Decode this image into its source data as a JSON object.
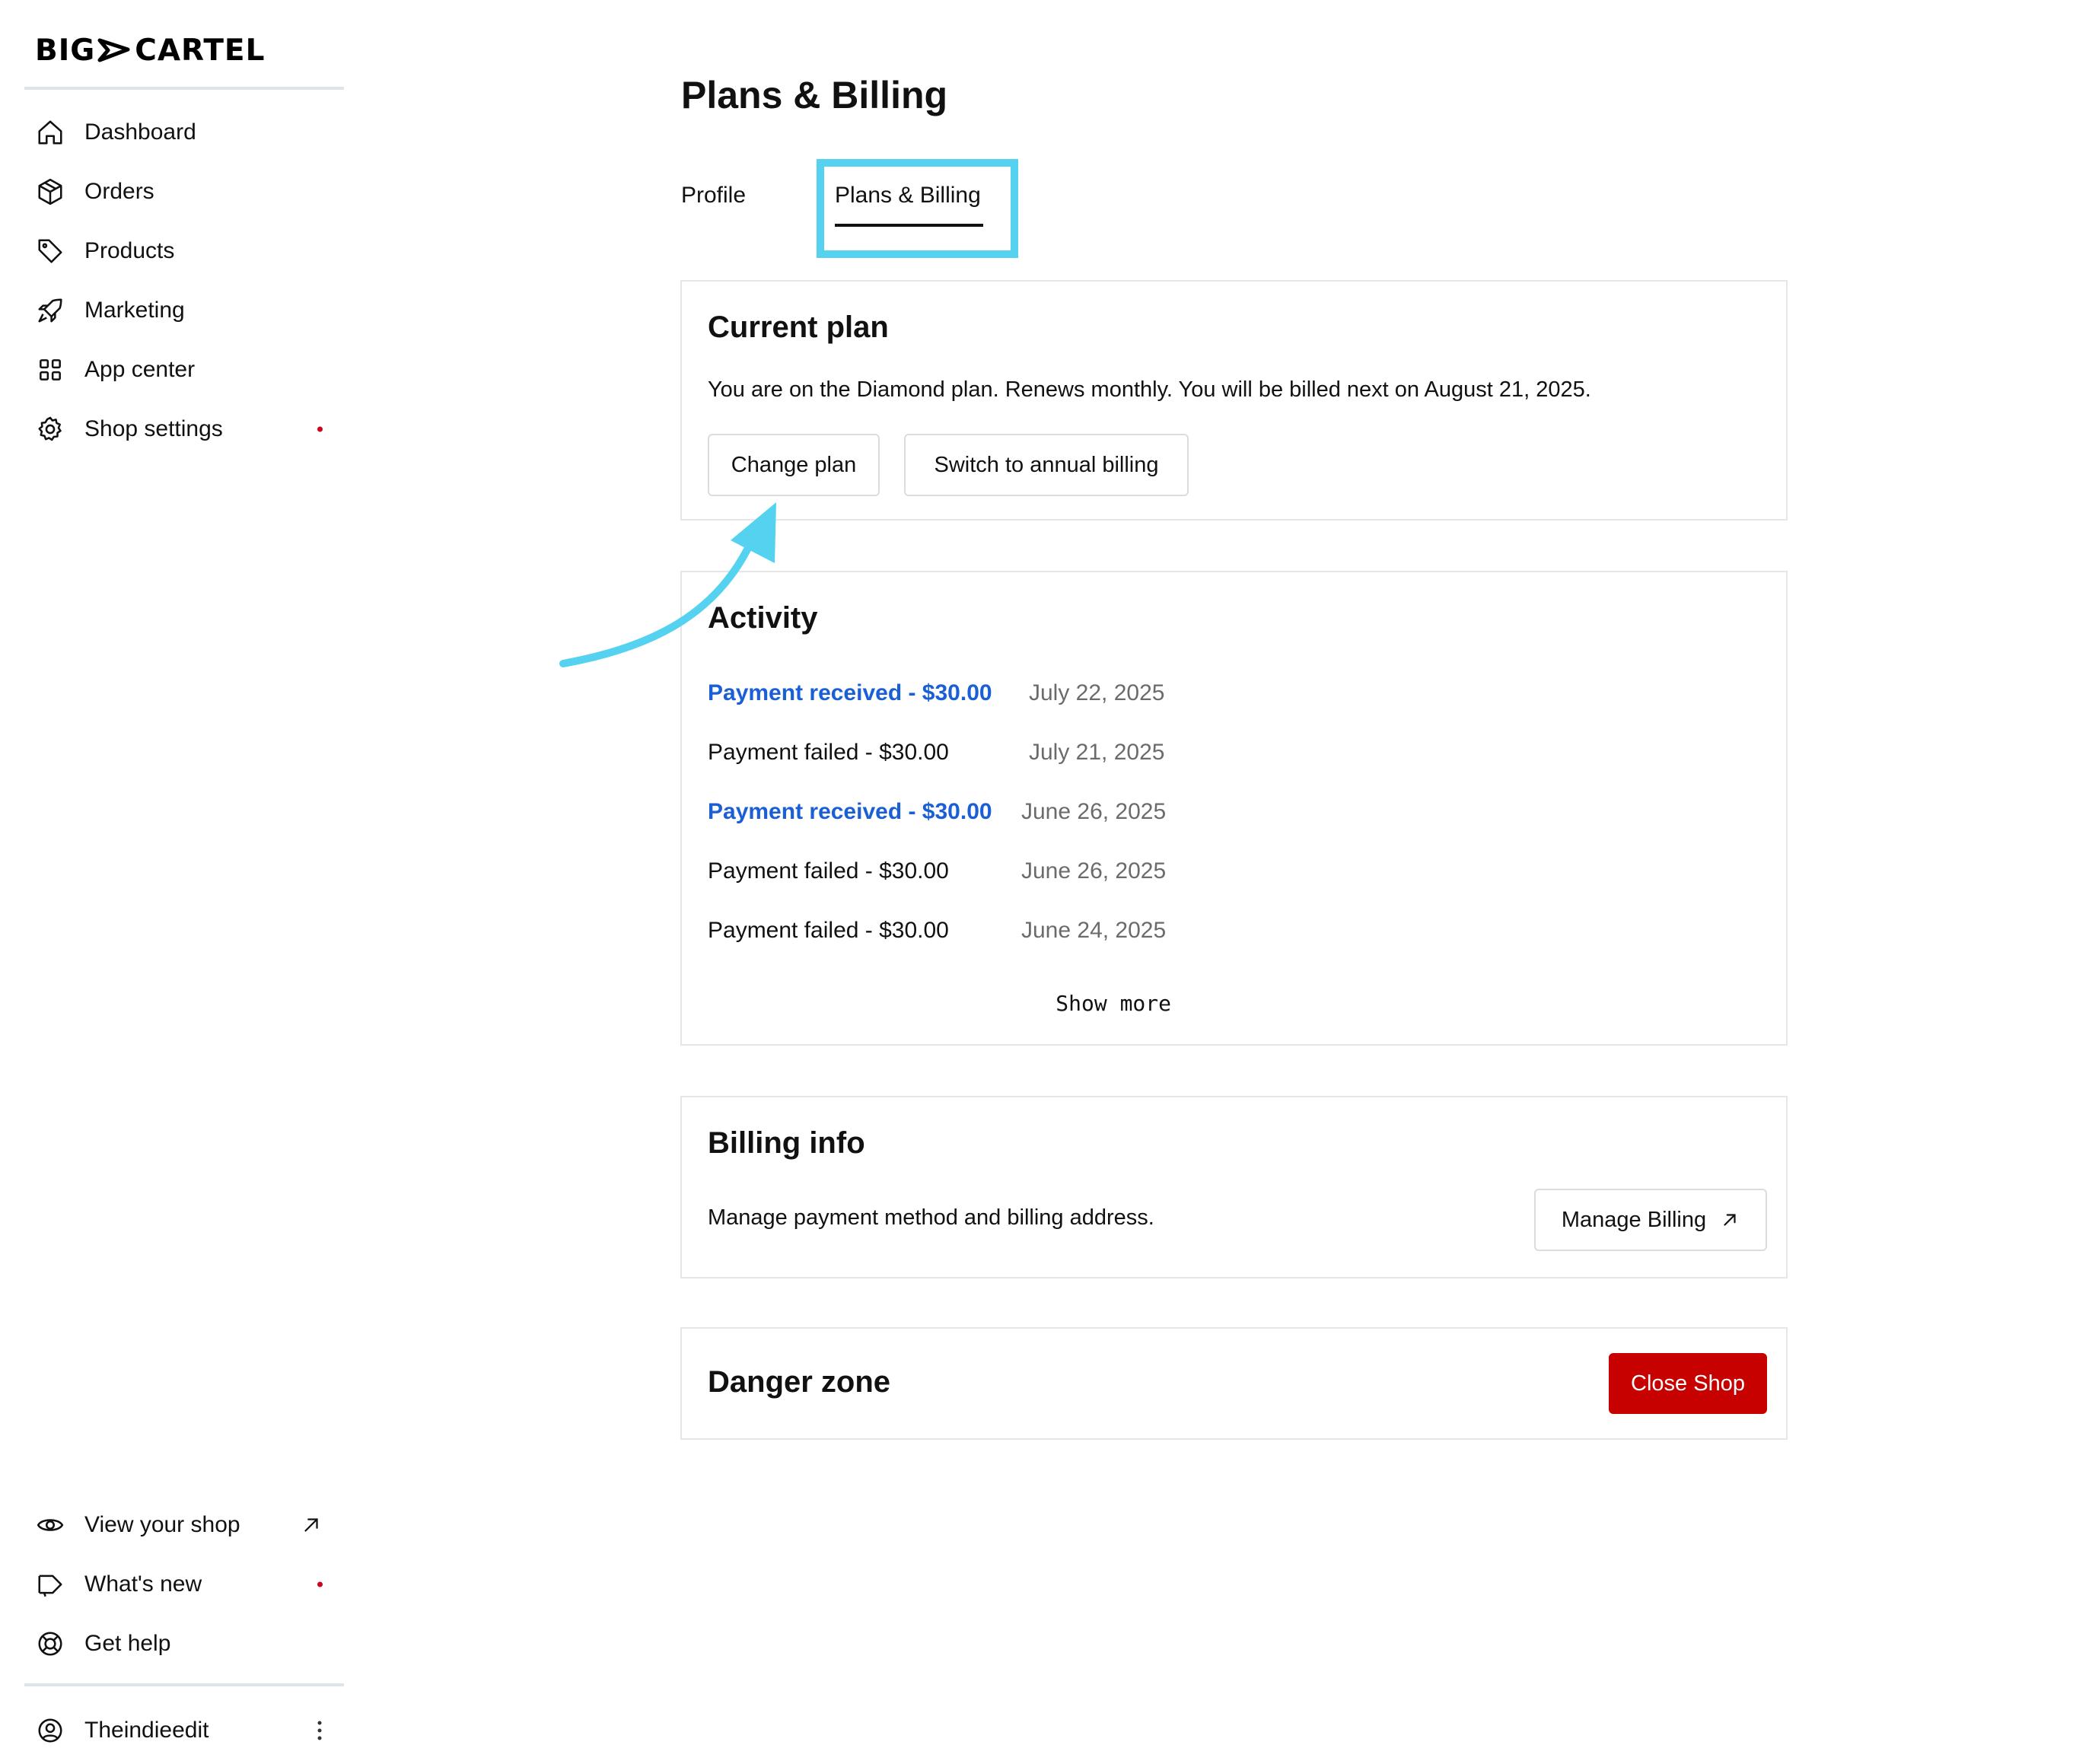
{
  "brand": {
    "part1": "BIG",
    "part2": "CARTEL"
  },
  "sidebar": {
    "nav": [
      {
        "label": "Dashboard",
        "icon": "home-icon"
      },
      {
        "label": "Orders",
        "icon": "box-icon"
      },
      {
        "label": "Products",
        "icon": "tag-icon"
      },
      {
        "label": "Marketing",
        "icon": "rocket-icon"
      },
      {
        "label": "App center",
        "icon": "grid-icon"
      },
      {
        "label": "Shop settings",
        "icon": "gear-icon",
        "notification": true
      }
    ],
    "footer": [
      {
        "label": "View your shop",
        "icon": "eye-icon",
        "external": true
      },
      {
        "label": "What's new",
        "icon": "megaphone-icon",
        "notification": true
      },
      {
        "label": "Get help",
        "icon": "lifebuoy-icon"
      }
    ],
    "account": {
      "label": "Theindieedit",
      "icon": "user-circle-icon"
    }
  },
  "page": {
    "title": "Plans & Billing",
    "tabs": [
      {
        "label": "Profile",
        "active": false
      },
      {
        "label": "Plans & Billing",
        "active": true
      }
    ]
  },
  "current_plan": {
    "heading": "Current plan",
    "description": "You are on the Diamond plan. Renews monthly. You will be billed next on August 21, 2025.",
    "change_plan_label": "Change plan",
    "annual_label": "Switch to annual billing"
  },
  "activity": {
    "heading": "Activity",
    "items": [
      {
        "description": "Payment received - $30.00",
        "date": "July 22, 2025",
        "status": "received"
      },
      {
        "description": "Payment failed - $30.00",
        "date": "July 21, 2025",
        "status": "failed"
      },
      {
        "description": "Payment received - $30.00",
        "date": "June 26, 2025",
        "status": "received"
      },
      {
        "description": "Payment failed - $30.00",
        "date": "June 26, 2025",
        "status": "failed"
      },
      {
        "description": "Payment failed - $30.00",
        "date": "June 24, 2025",
        "status": "failed"
      }
    ],
    "show_more_label": "Show more"
  },
  "billing_info": {
    "heading": "Billing info",
    "description": "Manage payment method and billing address.",
    "button_label": "Manage Billing"
  },
  "danger_zone": {
    "heading": "Danger zone",
    "button_label": "Close Shop"
  },
  "colors": {
    "link_blue": "#1a5fd6",
    "danger_red": "#c70000",
    "highlight_cyan": "#54d2f0",
    "notification_red": "#d0021b"
  }
}
